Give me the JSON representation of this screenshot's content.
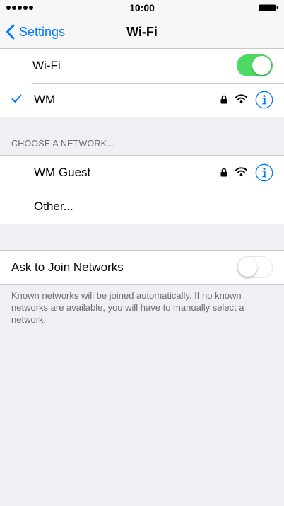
{
  "status_bar": {
    "time": "10:00"
  },
  "nav": {
    "back_label": "Settings",
    "title": "Wi-Fi"
  },
  "wifi_group": {
    "wifi_label": "Wi-Fi",
    "wifi_enabled": true,
    "connected_network": "WM"
  },
  "networks_section": {
    "header": "CHOOSE A NETWORK...",
    "networks": [
      {
        "name": "WM Guest",
        "secured": true
      }
    ],
    "other_label": "Other..."
  },
  "ask_to_join": {
    "label": "Ask to Join Networks",
    "enabled": false,
    "footer": "Known networks will be joined automatically. If no known networks are available, you will have to manually select a network."
  },
  "colors": {
    "accent": "#007aff",
    "toggle_on": "#4cd964",
    "background": "#efeff4",
    "secondary_text": "#6d6d72"
  },
  "icons": [
    "signal-dots-icon",
    "battery-icon",
    "chevron-left-icon",
    "checkmark-icon",
    "lock-icon",
    "wifi-icon",
    "info-icon"
  ]
}
